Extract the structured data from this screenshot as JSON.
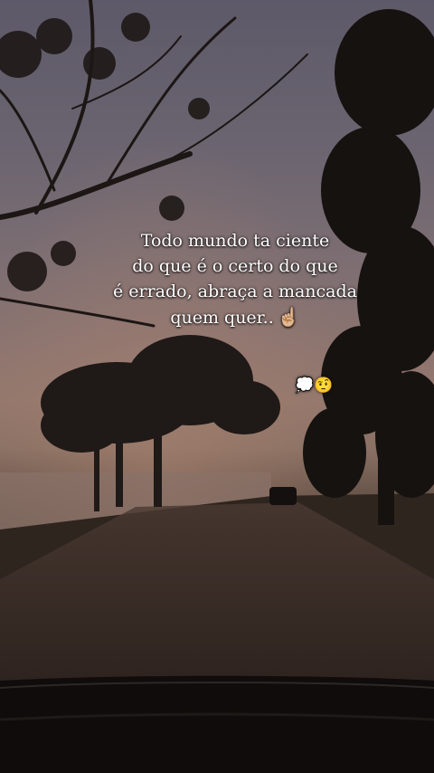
{
  "caption": {
    "line1": "Todo mundo ta ciente",
    "line2": "do que é o certo do que",
    "line3": "é errado, abraça a mancada",
    "line4": "quem quer..",
    "line4_emoji": "☝🏼"
  },
  "reaction": {
    "emojis": "💭🤨"
  },
  "colors": {
    "sky_top": "#5d5968",
    "sunset_glow": "#94786c",
    "ground": "#2e241f",
    "text": "#ffffff"
  }
}
